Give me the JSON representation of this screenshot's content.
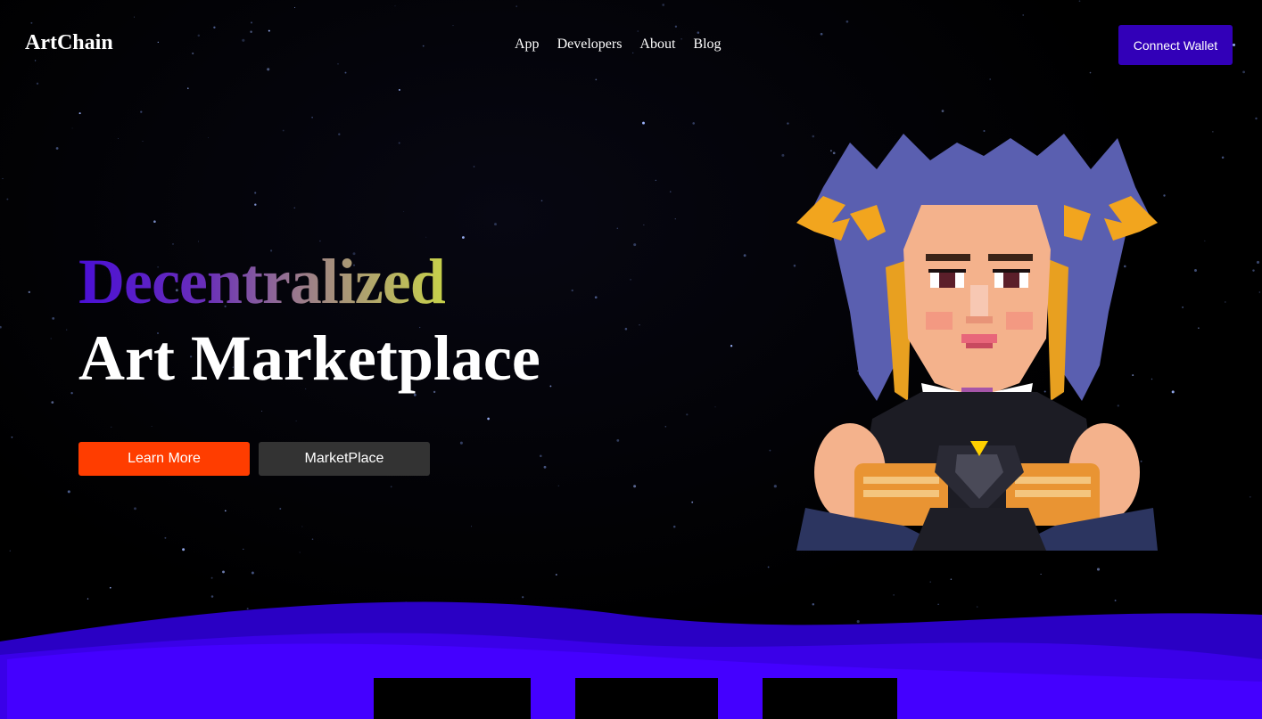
{
  "nav": {
    "logo": "ArtChain",
    "links": [
      {
        "label": "App"
      },
      {
        "label": "Developers"
      },
      {
        "label": "About"
      },
      {
        "label": "Blog"
      }
    ],
    "connect_label": "Connect Wallet"
  },
  "hero": {
    "title_line1": "Decentralized",
    "title_line2": "Art Marketplace",
    "primary_button": "Learn More",
    "secondary_button": "MarketPlace",
    "art_icon": "pixel-art-character-icon"
  },
  "colors": {
    "background": "#000000",
    "connect_button": "#3200b8",
    "primary_button": "#ff3d00",
    "secondary_button": "#333333",
    "wave_front": "#4400ff",
    "wave_back": "#2a00c4",
    "gradient_start": "#4a0fd6",
    "gradient_end": "#c8d24a"
  },
  "cards": [
    {
      "name": "bottom-card-1"
    },
    {
      "name": "bottom-card-2"
    },
    {
      "name": "bottom-card-3"
    }
  ]
}
